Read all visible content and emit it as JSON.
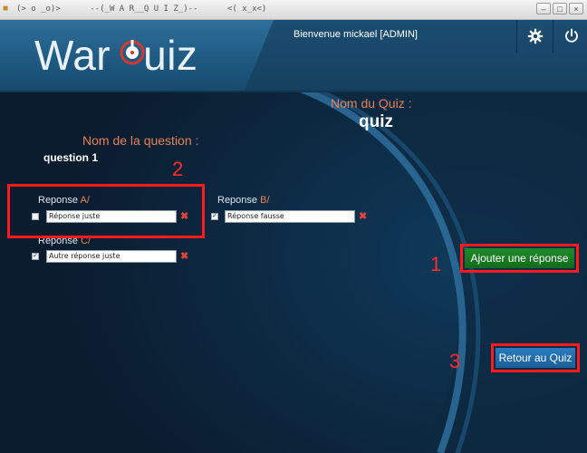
{
  "window": {
    "title": "(> o _o)>      --(_W A R__Q U I Z_)--      <( x_x<)",
    "buttons": [
      "minimize",
      "maximize",
      "close"
    ]
  },
  "header": {
    "logo_text_left": "War",
    "logo_text_right": "uiz",
    "welcome": "Bienvenue mickael [ADMIN]",
    "settings_icon": "gear-icon",
    "power_icon": "power-icon"
  },
  "quiz": {
    "label": "Nom du Quiz :",
    "name": "quiz"
  },
  "question": {
    "label": "Nom de la question :",
    "name": "question 1"
  },
  "responses": [
    {
      "label": "Reponse",
      "letter": "A/",
      "value": "Réponse juste",
      "checked": false
    },
    {
      "label": "Reponse",
      "letter": "B/",
      "value": "Réponse fausse",
      "checked": true
    },
    {
      "label": "Reponse",
      "letter": "C/",
      "value": "Autre réponse juste",
      "checked": true
    }
  ],
  "actions": {
    "add_response": "Ajouter une réponse",
    "back_to_quiz": "Retour au Quiz"
  },
  "annotations": [
    "1",
    "2",
    "3"
  ],
  "colors": {
    "accent_label": "#e88058",
    "annotation": "#ff1b1b",
    "add_button": "#1f8a2a",
    "back_button": "#2a7bc0"
  }
}
